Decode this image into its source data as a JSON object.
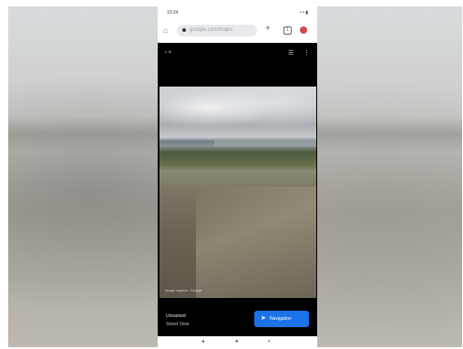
{
  "status_bar": {
    "time": "10:24",
    "indicators": "• • ▮"
  },
  "browser": {
    "url": "google.com/maps",
    "home_icon": "home-icon",
    "new_tab_label": "+",
    "tab_count": "1",
    "menu_icon": "more-vertical-icon"
  },
  "viewer": {
    "back_label": "‹ ×",
    "list_icon": "list-icon",
    "more_icon": "more-icon",
    "photo_caption": "Image capture: Google"
  },
  "place": {
    "name": "Unnamed",
    "subtitle": "Street View"
  },
  "navigation": {
    "button_label": "Navigation",
    "button_icon": "navigation-icon",
    "button_color": "#1a73e8"
  },
  "system_nav": {
    "back_icon": "back-icon",
    "home_icon": "home-icon",
    "recents_icon": "recents-icon"
  }
}
